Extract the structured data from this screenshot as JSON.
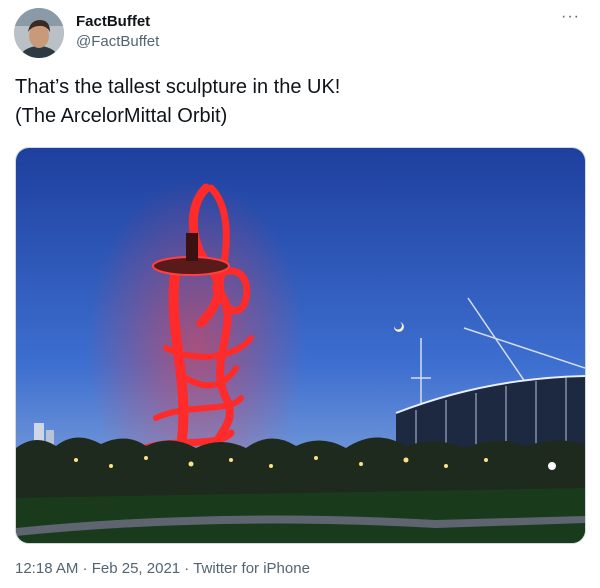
{
  "author": {
    "display_name": "FactBuffet",
    "handle": "@FactBuffet"
  },
  "tweet": {
    "line1": "That’s the tallest sculpture in the UK!",
    "line2": "(The ArcelorMittal Orbit)"
  },
  "media": {
    "icon": "photo"
  },
  "meta": {
    "time": "12:18 AM",
    "sep1": " · ",
    "date": "Feb 25, 2021",
    "sep2": " · ",
    "source": "Twitter for iPhone"
  },
  "more_icon": "···"
}
